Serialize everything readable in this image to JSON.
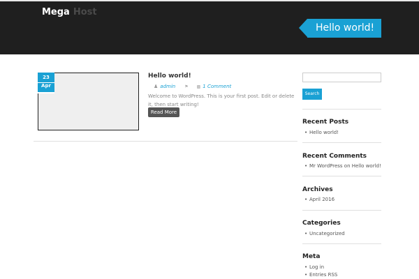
{
  "header": {
    "site_name_part1": "Mega",
    "site_name_part2": "Host",
    "page_title": "Hello world!"
  },
  "post": {
    "date_day": "23",
    "date_month": "Apr",
    "title": "Hello world!",
    "author": "admin",
    "comments": "1 Comment",
    "excerpt": "Welcome to WordPress. This is your first post. Edit or delete it, then start writing!",
    "read_more": "Read More"
  },
  "sidebar": {
    "search_value": "",
    "search_button": "Search",
    "recent_posts": {
      "title": "Recent Posts",
      "items": [
        "Hello world!"
      ]
    },
    "recent_comments": {
      "title": "Recent Comments",
      "items": [
        "Mr WordPress on Hello world!"
      ]
    },
    "archives": {
      "title": "Archives",
      "items": [
        "April 2016"
      ]
    },
    "categories": {
      "title": "Categories",
      "items": [
        "Uncategorized"
      ]
    },
    "meta": {
      "title": "Meta",
      "items": [
        "Log in",
        "Entries RSS"
      ]
    }
  },
  "colors": {
    "accent": "#1aa1d4",
    "header_bg": "#1f1f1f"
  },
  "icons": {
    "author": "user-icon",
    "tag": "tag-icon",
    "comments": "comment-icon"
  }
}
